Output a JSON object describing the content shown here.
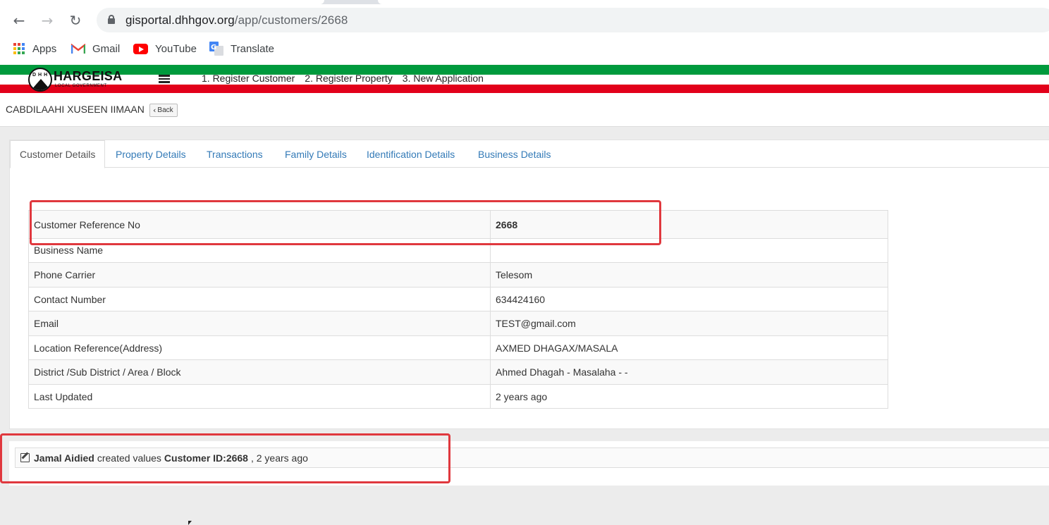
{
  "browser": {
    "url_host": "gisportal.dhhgov.org",
    "url_path": "/app/customers/2668",
    "bookmarks": [
      {
        "label": "Apps",
        "icon": "apps-grid-icon"
      },
      {
        "label": "Gmail",
        "icon": "gmail-icon"
      },
      {
        "label": "YouTube",
        "icon": "youtube-icon"
      },
      {
        "label": "Translate",
        "icon": "translate-icon"
      }
    ]
  },
  "app": {
    "logo_text": "HARGEISA",
    "logo_sub": "LOCAL GOVERNMENT",
    "logo_badge": "DHH",
    "nav": [
      "1. Register Customer",
      "2. Register Property",
      "3. New Application"
    ]
  },
  "page": {
    "customer_name": "CABDILAAHI XUSEEN IIMAAN",
    "back_label": "Back"
  },
  "tabs": [
    {
      "label": "Customer Details",
      "active": true
    },
    {
      "label": "Property Details",
      "active": false
    },
    {
      "label": "Transactions",
      "active": false
    },
    {
      "label": "Family Details",
      "active": false
    },
    {
      "label": "Identification Details",
      "active": false
    },
    {
      "label": "Business Details",
      "active": false
    }
  ],
  "details": [
    {
      "key": "Customer Reference No",
      "value": "2668",
      "bold": true
    },
    {
      "key": "Business Name",
      "value": ""
    },
    {
      "key": "Phone Carrier",
      "value": "Telesom"
    },
    {
      "key": "Contact Number",
      "value": "634424160"
    },
    {
      "key": "Email",
      "value": "TEST@gmail.com"
    },
    {
      "key": "Location Reference(Address)",
      "value": "AXMED DHAGAX/MASALA"
    },
    {
      "key": "District /Sub District / Area / Block",
      "value": "Ahmed Dhagah - Masalaha - -"
    },
    {
      "key": "Last Updated",
      "value": "2 years ago"
    }
  ],
  "activity": {
    "user": "Jamal Aidied",
    "action": "created values",
    "target": "Customer ID:2668",
    "time": ", 2 years ago"
  },
  "colors": {
    "green_stripe": "#009a3d",
    "red_stripe": "#e2001a",
    "link": "#337ab7",
    "highlight": "#e0383e"
  }
}
